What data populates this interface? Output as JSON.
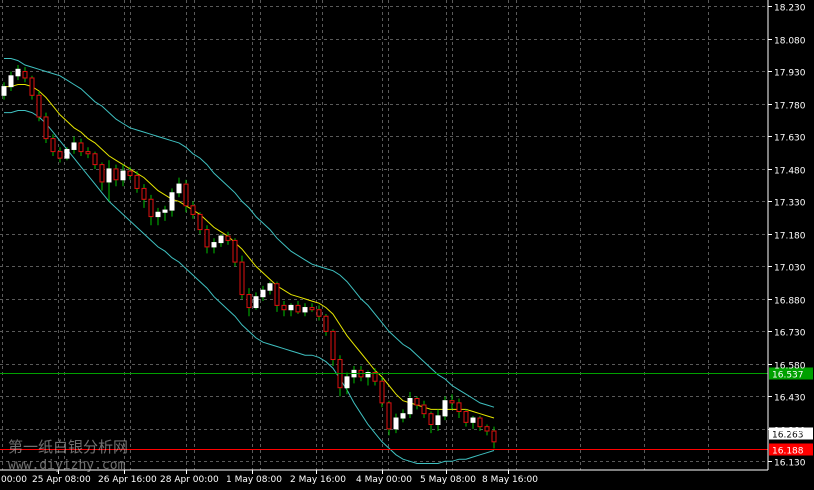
{
  "chart_data": {
    "type": "candlestick",
    "ylim": [
      16.09,
      18.26
    ],
    "y_ticks": [
      "18.230",
      "18.080",
      "17.930",
      "17.780",
      "17.630",
      "17.480",
      "17.330",
      "17.180",
      "17.030",
      "16.880",
      "16.730",
      "16.580",
      "16.430",
      "16.280",
      "16.130"
    ],
    "x_ticks": [
      "25 Apr 08:00",
      "26 Apr 16:00",
      "28 Apr 00:00",
      "1 May 08:00",
      "2 May 16:00",
      "4 May 00:00",
      "5 May 08:00",
      "8 May 16:00"
    ],
    "x_edge_label": "00:00",
    "grid": true,
    "candles": [
      [
        17.82,
        17.88,
        17.8,
        17.86
      ],
      [
        17.86,
        17.93,
        17.84,
        17.91
      ],
      [
        17.91,
        17.96,
        17.89,
        17.94
      ],
      [
        17.93,
        17.95,
        17.88,
        17.9
      ],
      [
        17.9,
        17.91,
        17.8,
        17.82
      ],
      [
        17.82,
        17.84,
        17.7,
        17.72
      ],
      [
        17.72,
        17.74,
        17.6,
        17.62
      ],
      [
        17.62,
        17.64,
        17.54,
        17.56
      ],
      [
        17.56,
        17.58,
        17.51,
        17.53
      ],
      [
        17.53,
        17.58,
        17.52,
        17.57
      ],
      [
        17.57,
        17.63,
        17.55,
        17.6
      ],
      [
        17.6,
        17.62,
        17.54,
        17.56
      ],
      [
        17.56,
        17.58,
        17.53,
        17.55
      ],
      [
        17.55,
        17.56,
        17.48,
        17.5
      ],
      [
        17.5,
        17.51,
        17.38,
        17.42
      ],
      [
        17.42,
        17.52,
        17.33,
        17.48
      ],
      [
        17.48,
        17.5,
        17.4,
        17.43
      ],
      [
        17.43,
        17.5,
        17.4,
        17.47
      ],
      [
        17.47,
        17.49,
        17.43,
        17.45
      ],
      [
        17.45,
        17.47,
        17.37,
        17.39
      ],
      [
        17.39,
        17.41,
        17.3,
        17.34
      ],
      [
        17.34,
        17.36,
        17.22,
        17.26
      ],
      [
        17.26,
        17.3,
        17.22,
        17.28
      ],
      [
        17.28,
        17.31,
        17.24,
        17.29
      ],
      [
        17.29,
        17.39,
        17.26,
        17.37
      ],
      [
        17.37,
        17.44,
        17.35,
        17.41
      ],
      [
        17.41,
        17.43,
        17.28,
        17.31
      ],
      [
        17.31,
        17.33,
        17.25,
        17.27
      ],
      [
        17.27,
        17.28,
        17.18,
        17.2
      ],
      [
        17.2,
        17.22,
        17.09,
        17.12
      ],
      [
        17.12,
        17.16,
        17.09,
        17.14
      ],
      [
        17.14,
        17.18,
        17.12,
        17.17
      ],
      [
        17.17,
        17.19,
        17.13,
        17.15
      ],
      [
        17.15,
        17.16,
        17.03,
        17.05
      ],
      [
        17.05,
        17.08,
        16.88,
        16.9
      ],
      [
        16.9,
        16.93,
        16.8,
        16.84
      ],
      [
        16.84,
        16.91,
        16.83,
        16.89
      ],
      [
        16.89,
        16.94,
        16.87,
        16.92
      ],
      [
        16.92,
        16.96,
        16.9,
        16.95
      ],
      [
        16.95,
        16.96,
        16.82,
        16.85
      ],
      [
        16.85,
        16.87,
        16.8,
        16.83
      ],
      [
        16.83,
        16.86,
        16.8,
        16.85
      ],
      [
        16.85,
        16.87,
        16.81,
        16.82
      ],
      [
        16.82,
        16.86,
        16.8,
        16.84
      ],
      [
        16.84,
        16.86,
        16.82,
        16.83
      ],
      [
        16.83,
        16.85,
        16.78,
        16.8
      ],
      [
        16.8,
        16.81,
        16.71,
        16.73
      ],
      [
        16.73,
        16.74,
        16.57,
        16.6
      ],
      [
        16.6,
        16.62,
        16.43,
        16.47
      ],
      [
        16.47,
        16.54,
        16.44,
        16.52
      ],
      [
        16.52,
        16.57,
        16.49,
        16.55
      ],
      [
        16.55,
        16.57,
        16.5,
        16.52
      ],
      [
        16.52,
        16.55,
        16.48,
        16.54
      ],
      [
        16.54,
        16.56,
        16.48,
        16.5
      ],
      [
        16.5,
        16.52,
        16.38,
        16.4
      ],
      [
        16.4,
        16.41,
        16.25,
        16.28
      ],
      [
        16.28,
        16.35,
        16.26,
        16.33
      ],
      [
        16.33,
        16.37,
        16.31,
        16.35
      ],
      [
        16.35,
        16.45,
        16.33,
        16.42
      ],
      [
        16.42,
        16.43,
        16.37,
        16.39
      ],
      [
        16.39,
        16.41,
        16.33,
        16.35
      ],
      [
        16.35,
        16.36,
        16.26,
        16.3
      ],
      [
        16.3,
        16.37,
        16.27,
        16.34
      ],
      [
        16.34,
        16.43,
        16.32,
        16.41
      ],
      [
        16.41,
        16.44,
        16.37,
        16.4
      ],
      [
        16.4,
        16.42,
        16.33,
        16.36
      ],
      [
        16.36,
        16.37,
        16.29,
        16.31
      ],
      [
        16.31,
        16.34,
        16.28,
        16.33
      ],
      [
        16.33,
        16.34,
        16.27,
        16.29
      ],
      [
        16.29,
        16.3,
        16.25,
        16.27
      ],
      [
        16.27,
        16.29,
        16.19,
        16.22
      ]
    ],
    "ma": [
      17.86,
      17.86,
      17.87,
      17.87,
      17.86,
      17.84,
      17.81,
      17.77,
      17.73,
      17.7,
      17.67,
      17.65,
      17.62,
      17.6,
      17.57,
      17.54,
      17.52,
      17.5,
      17.48,
      17.46,
      17.44,
      17.41,
      17.38,
      17.36,
      17.34,
      17.33,
      17.31,
      17.29,
      17.27,
      17.24,
      17.21,
      17.19,
      17.17,
      17.14,
      17.11,
      17.07,
      17.03,
      17.0,
      16.97,
      16.94,
      16.92,
      16.9,
      16.89,
      16.88,
      16.87,
      16.86,
      16.84,
      16.81,
      16.76,
      16.71,
      16.67,
      16.63,
      16.59,
      16.55,
      16.52,
      16.48,
      16.44,
      16.41,
      16.4,
      16.39,
      16.38,
      16.37,
      16.37,
      16.37,
      16.37,
      16.37,
      16.37,
      16.36,
      16.35,
      16.34,
      16.33
    ],
    "band_upper": [
      17.99,
      17.99,
      17.98,
      17.96,
      17.95,
      17.94,
      17.93,
      17.92,
      17.91,
      17.89,
      17.87,
      17.85,
      17.82,
      17.79,
      17.77,
      17.74,
      17.71,
      17.69,
      17.67,
      17.66,
      17.65,
      17.64,
      17.63,
      17.62,
      17.61,
      17.6,
      17.58,
      17.55,
      17.53,
      17.5,
      17.46,
      17.43,
      17.4,
      17.37,
      17.33,
      17.3,
      17.26,
      17.23,
      17.2,
      17.16,
      17.13,
      17.1,
      17.08,
      17.06,
      17.04,
      17.03,
      17.02,
      17.01,
      16.99,
      16.96,
      16.92,
      16.88,
      16.85,
      16.81,
      16.77,
      16.73,
      16.7,
      16.67,
      16.65,
      16.62,
      16.59,
      16.56,
      16.53,
      16.51,
      16.48,
      16.46,
      16.44,
      16.42,
      16.4,
      16.39,
      16.38
    ],
    "band_lower": [
      17.74,
      17.74,
      17.75,
      17.75,
      17.74,
      17.72,
      17.69,
      17.65,
      17.61,
      17.57,
      17.53,
      17.49,
      17.45,
      17.41,
      17.37,
      17.33,
      17.3,
      17.27,
      17.24,
      17.21,
      17.18,
      17.15,
      17.12,
      17.1,
      17.07,
      17.05,
      17.02,
      16.99,
      16.96,
      16.93,
      16.89,
      16.86,
      16.83,
      16.8,
      16.76,
      16.73,
      16.7,
      16.68,
      16.67,
      16.66,
      16.65,
      16.64,
      16.63,
      16.62,
      16.62,
      16.61,
      16.59,
      16.56,
      16.51,
      16.46,
      16.4,
      16.35,
      16.3,
      16.26,
      16.22,
      16.19,
      16.16,
      16.14,
      16.13,
      16.12,
      16.12,
      16.12,
      16.12,
      16.13,
      16.13,
      16.14,
      16.14,
      16.15,
      16.16,
      16.17,
      16.18
    ],
    "horizontal_lines": [
      {
        "value": 16.537,
        "label": "16.537",
        "color": "#00a000"
      },
      {
        "value": 16.188,
        "label": "16.188",
        "color": "#ff0000"
      }
    ],
    "current_price": {
      "value": 16.263,
      "label": "16.263"
    },
    "colors": {
      "background": "#000000",
      "grid": "#5a5a5a",
      "axis_text": "#ffffff",
      "candle_up": "#ffffff",
      "candle_down": "#e01010",
      "wick": "#00c000",
      "ma_line": "#e6e600",
      "band_line": "#3fc0c0"
    }
  },
  "watermark": {
    "line1": "第一纸白银分析网",
    "line2": "www.diyizhy.com"
  }
}
